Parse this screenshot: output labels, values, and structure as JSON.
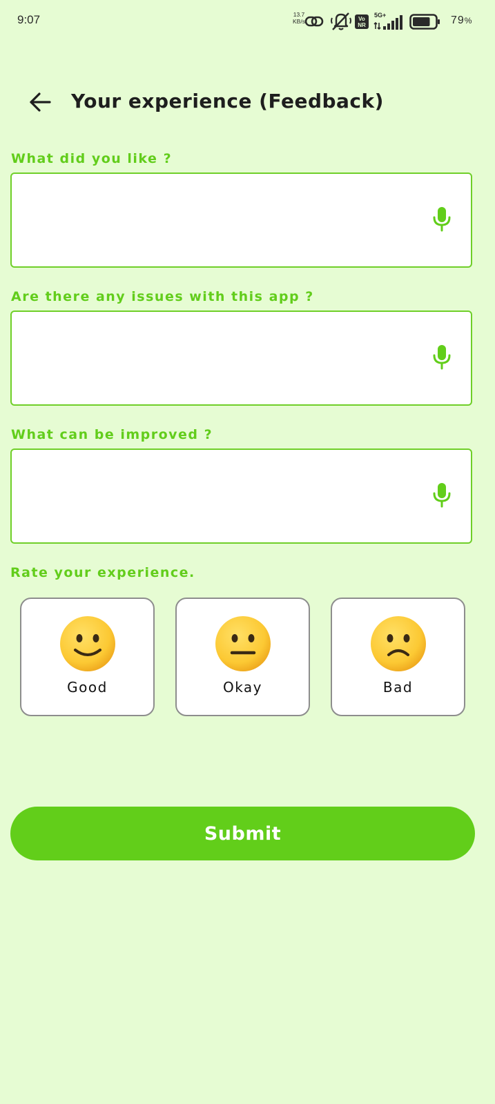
{
  "status_bar": {
    "time": "9:07",
    "net_speed_value": "13.7",
    "net_speed_unit": "KB/s",
    "volte_badge_top": "Vo",
    "volte_badge_bottom": "NR",
    "network_type": "5G+",
    "battery_percent": "79",
    "battery_percent_sign": "%",
    "battery_level": 0.79
  },
  "header": {
    "title": "Your experience (Feedback)"
  },
  "form": {
    "fields": [
      {
        "label": "What did you like ?",
        "value": ""
      },
      {
        "label": "Are there any issues with this app ?",
        "value": ""
      },
      {
        "label": "What can be improved ?",
        "value": ""
      }
    ]
  },
  "rating": {
    "label": "Rate your experience.",
    "options": [
      {
        "label": "Good",
        "icon": "slightly-smiling-face-icon"
      },
      {
        "label": "Okay",
        "icon": "neutral-face-icon"
      },
      {
        "label": "Bad",
        "icon": "frowning-face-icon"
      }
    ]
  },
  "submit_label": "Submit",
  "colors": {
    "background": "#e6fcd3",
    "accent": "#62ce1a",
    "label_text": "#62cd1b",
    "emoji_face": "#ffcc33"
  }
}
